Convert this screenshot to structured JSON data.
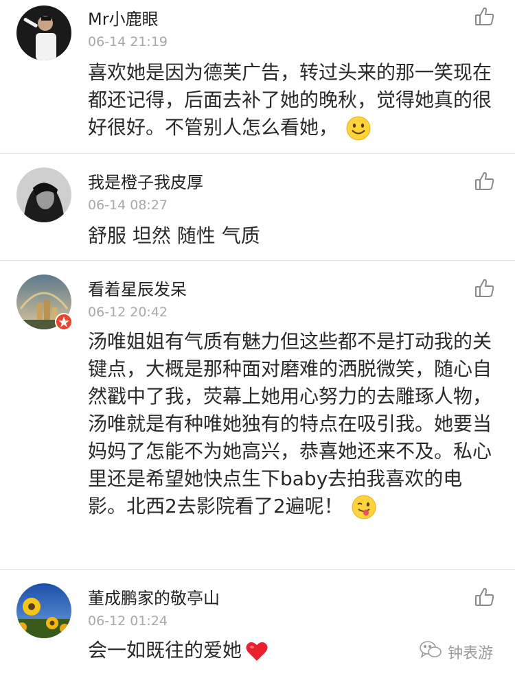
{
  "comments": [
    {
      "username": "Mr小鹿眼",
      "time": "06-14 21:19",
      "text": "喜欢她是因为德芙广告，转过头来的那一笑现在都还记得，后面去补了她的晚秋，觉得她真的很好很好。不管别人怎么看她，",
      "emoji": "smile-emoji"
    },
    {
      "username": "我是橙子我皮厚",
      "time": "06-14 08:27",
      "text": "舒服 坦然 随性 气质"
    },
    {
      "username": "看着星辰发呆",
      "time": "06-12 20:42",
      "text": "汤唯姐姐有气质有魅力但这些都不是打动我的关键点，大概是那种面对磨难的洒脱微笑，随心自然戳中了我，荧幕上她用心努力的去雕琢人物，汤唯就是有种唯她独有的特点在吸引我。她要当妈妈了怎能不为她高兴，恭喜她还来不及。私心里还是希望她快点生下baby去拍我喜欢的电影。北西2去影院看了2遍呢！",
      "emoji": "tongue-wink-emoji"
    },
    {
      "username": "董成鹏家的敬亭山",
      "time": "06-12 01:24",
      "text": "会一如既往的爱她",
      "emoji": "heart-emoji"
    }
  ],
  "watermark": {
    "text": "钟表游",
    "icon": "wechat-icon"
  },
  "colors": {
    "text": "#2a2a2a",
    "meta": "#a8a8a8",
    "divider": "#e2e2e2",
    "badge": "#e8452e"
  }
}
